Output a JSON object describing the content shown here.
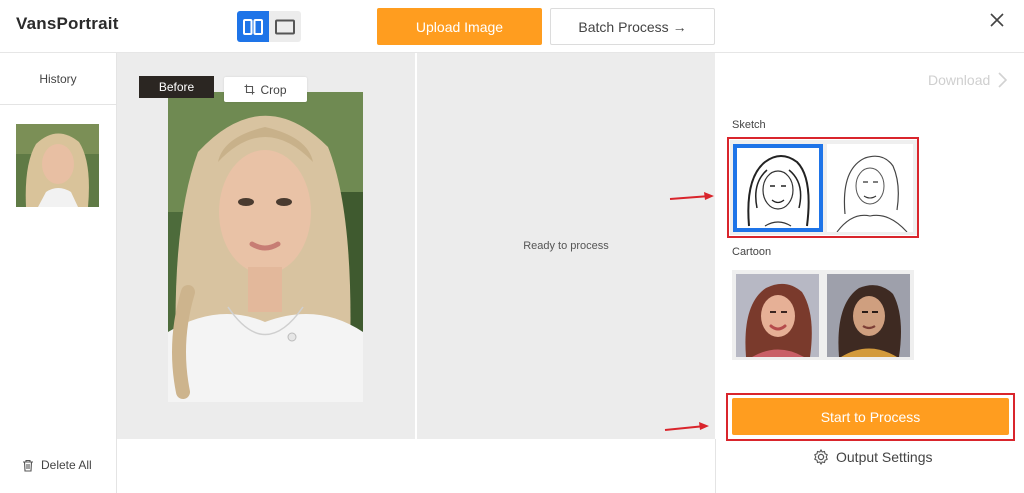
{
  "header": {
    "app_title": "VansPortrait",
    "upload_label": "Upload Image",
    "batch_label": "Batch Process →"
  },
  "sidebar": {
    "history_label": "History",
    "delete_all_label": "Delete All"
  },
  "canvas": {
    "before_label": "Before",
    "crop_label": "Crop",
    "ready_text": "Ready to process"
  },
  "right_panel": {
    "download_label": "Download",
    "sketch_label": "Sketch",
    "cartoon_label": "Cartoon",
    "process_label": "Start to Process",
    "output_settings_label": "Output Settings"
  },
  "colors": {
    "accent_orange": "#ff9d1f",
    "toggle_blue": "#1e74e8",
    "highlight_red": "#d9252c",
    "selected_blue": "#1e74e8"
  },
  "icons": [
    "split-view-icon",
    "single-view-icon",
    "close-icon",
    "crop-icon",
    "trash-icon",
    "chevron-right-icon",
    "gear-icon",
    "arrow-icon"
  ]
}
